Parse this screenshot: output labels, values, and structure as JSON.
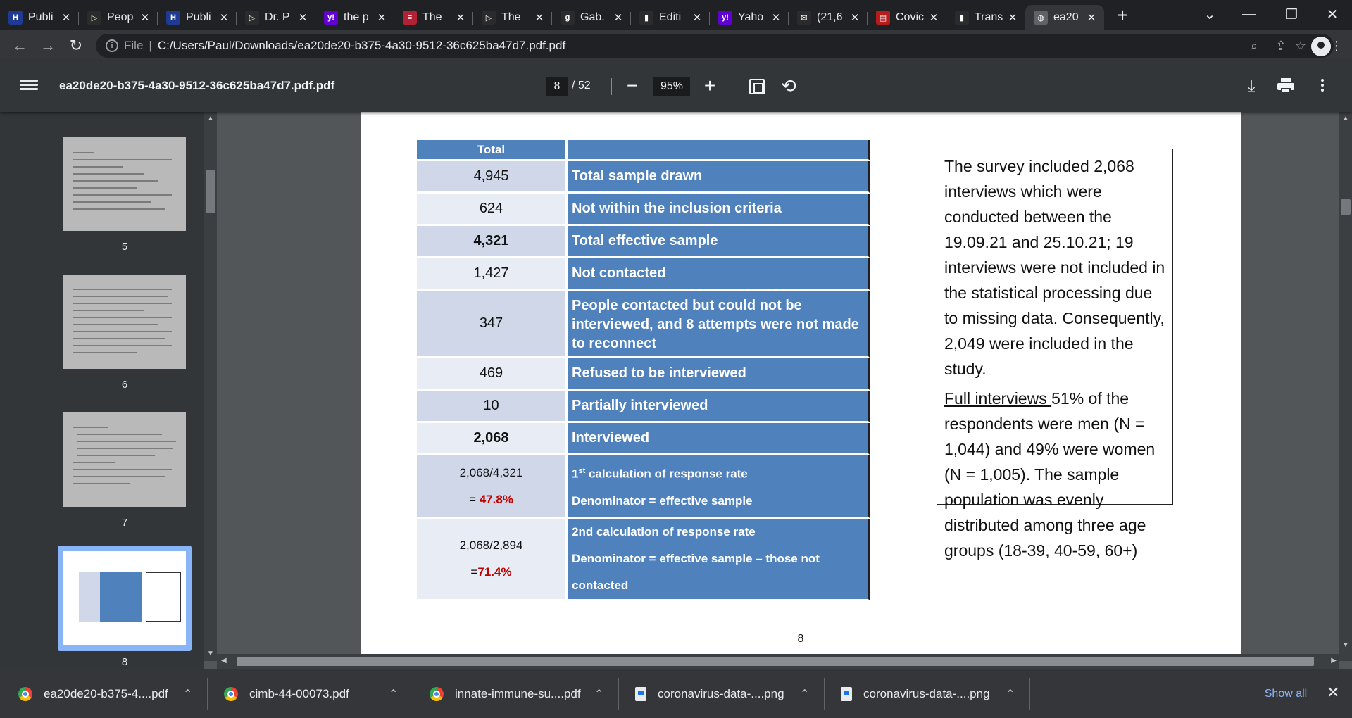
{
  "tabs": [
    {
      "title": "Publi",
      "icon": "health-logo-icon",
      "color": "#1f3a93"
    },
    {
      "title": "Peop",
      "icon": "rumble-play-icon",
      "color": "#2b2b2b"
    },
    {
      "title": "Publi",
      "icon": "health-logo-icon",
      "color": "#1f3a93"
    },
    {
      "title": "Dr. P",
      "icon": "rumble-play-icon",
      "color": "#2b2b2b"
    },
    {
      "title": "the p",
      "icon": "yahoo-icon",
      "color": "#6001d2"
    },
    {
      "title": "The",
      "icon": "us-flag-icon",
      "color": "#b22234"
    },
    {
      "title": "The",
      "icon": "rumble-play-icon",
      "color": "#2b2b2b"
    },
    {
      "title": "Gab.",
      "icon": "gab-icon",
      "color": "#2b2b2b"
    },
    {
      "title": "Editi",
      "icon": "bookmark-icon",
      "color": "#2b2b2b"
    },
    {
      "title": "Yaho",
      "icon": "yahoo-icon",
      "color": "#6001d2"
    },
    {
      "title": "(21,6",
      "icon": "yahoo-mail-icon",
      "color": "#2b2b2b"
    },
    {
      "title": "Covic",
      "icon": "red-book-icon",
      "color": "#b71c1c"
    },
    {
      "title": "Trans",
      "icon": "bookmark-icon",
      "color": "#2b2b2b"
    },
    {
      "title": "ea20",
      "icon": "globe-icon",
      "color": "#5f6368"
    }
  ],
  "address": {
    "scheme_label": "File",
    "url": "C:/Users/Paul/Downloads/ea20de20-b375-4a30-9512-36c625ba47d7.pdf.pdf"
  },
  "pdf": {
    "title": "ea20de20-b375-4a30-9512-36c625ba47d7.pdf.pdf",
    "current_page": "8",
    "total_pages": "/ 52",
    "zoom": "95%",
    "zoom_out": "−",
    "zoom_in": "+"
  },
  "thumbnails": [
    {
      "label": "5"
    },
    {
      "label": "6"
    },
    {
      "label": "7"
    },
    {
      "label": "8",
      "selected": true
    }
  ],
  "table": {
    "header": "Total",
    "rows": [
      {
        "value": "4,945",
        "label": "Total sample drawn",
        "bold": false
      },
      {
        "value": "624",
        "label": "Not within the inclusion criteria",
        "bold": false
      },
      {
        "value": "4,321",
        "label": "Total effective sample",
        "bold": true
      },
      {
        "value": "1,427",
        "label": "Not contacted",
        "bold": false
      },
      {
        "value": "347",
        "label": "People contacted but could not be interviewed, and 8 attempts were not made to reconnect",
        "bold": false
      },
      {
        "value": "469",
        "label": "Refused to be interviewed",
        "bold": false
      },
      {
        "value": "10",
        "label": "Partially interviewed",
        "bold": false
      },
      {
        "value": "2,068",
        "label": "Interviewed",
        "bold": true
      }
    ],
    "calc1": {
      "fraction": "2,068/4,321",
      "result_prefix": "= ",
      "result": "47.8%",
      "label_sup": "st",
      "label_num": "1",
      "label_rest": " calculation of response rate",
      "denominator": "Denominator = effective sample"
    },
    "calc2": {
      "fraction": "2,068/2,894",
      "result_prefix": "=",
      "result": "71.4%",
      "label": "2nd calculation of response rate",
      "denominator": "Denominator = effective sample – those not contacted"
    }
  },
  "textbox": {
    "para1": "The survey included 2,068 interviews which were conducted between the 19.09.21 and 25.10.21; 19 interviews were not included in the statistical processing due to missing data. Consequently, 2,049 were included in the study.",
    "para2_underlined": "Full interviews ",
    "para2_rest": "51% of the respondents were men (N = 1,044) and 49% were women (N = 1,005). The sample population was evenly distributed among three age groups (18-39, 40-59, 60+)"
  },
  "page_number": "8",
  "downloads": [
    {
      "name": "ea20de20-b375-4....pdf",
      "icon": "chrome-icon"
    },
    {
      "name": "cimb-44-00073.pdf",
      "icon": "chrome-icon"
    },
    {
      "name": "innate-immune-su....pdf",
      "icon": "chrome-icon"
    },
    {
      "name": "coronavirus-data-....png",
      "icon": "file-icon"
    },
    {
      "name": "coronavirus-data-....png",
      "icon": "file-icon"
    }
  ],
  "show_all": "Show all"
}
